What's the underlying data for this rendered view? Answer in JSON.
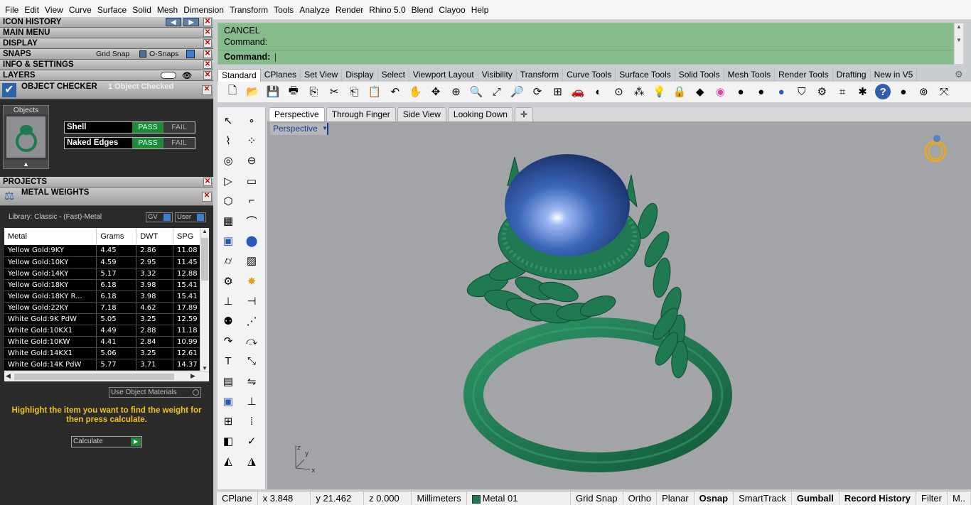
{
  "menu": [
    "File",
    "Edit",
    "View",
    "Curve",
    "Surface",
    "Solid",
    "Mesh",
    "Dimension",
    "Transform",
    "Tools",
    "Analyze",
    "Render",
    "Rhino 5.0",
    "Blend",
    "Clayoo",
    "Help"
  ],
  "panels": {
    "icon_history": "ICON HISTORY",
    "main_menu": "MAIN MENU",
    "display": "DISPLAY",
    "snaps": "SNAPS",
    "grid_snap": "Grid Snap",
    "o_snaps": "O-Snaps",
    "info_settings": "INFO & SETTINGS",
    "layers": "LAYERS",
    "object_checker": "OBJECT CHECKER",
    "object_checked": "1 Object Checked",
    "objects_label": "Objects",
    "checks": [
      {
        "name": "Shell",
        "pass": "PASS",
        "fail": "FAIL"
      },
      {
        "name": "Naked Edges",
        "pass": "PASS",
        "fail": "FAIL"
      }
    ],
    "projects": "PROJECTS",
    "metal_weights": "METAL WEIGHTS",
    "library": "Library: Classic - (Fast)-Metal",
    "gv": "GV",
    "user": "User",
    "use_object_materials": "Use Object Materials",
    "hint": "Highlight the item you want to find the weight for then press calculate.",
    "calculate": "Calculate"
  },
  "metal_table": {
    "headers": [
      "Metal",
      "Grams",
      "DWT",
      "SPG"
    ],
    "rows": [
      [
        "Yellow Gold:9KY",
        "4.45",
        "2.86",
        "11.08"
      ],
      [
        "Yellow Gold:10KY",
        "4.59",
        "2.95",
        "11.45"
      ],
      [
        "Yellow Gold:14KY",
        "5.17",
        "3.32",
        "12.88"
      ],
      [
        "Yellow Gold:18KY",
        "6.18",
        "3.98",
        "15.41"
      ],
      [
        "Yellow Gold:18KY R...",
        "6.18",
        "3.98",
        "15.41"
      ],
      [
        "Yellow Gold:22KY",
        "7.18",
        "4.62",
        "17.89"
      ],
      [
        "White Gold:9K PdW",
        "5.05",
        "3.25",
        "12.59"
      ],
      [
        "White Gold:10KX1",
        "4.49",
        "2.88",
        "11.18"
      ],
      [
        "White Gold:10KW",
        "4.41",
        "2.84",
        "10.99"
      ],
      [
        "White Gold:14KX1",
        "5.06",
        "3.25",
        "12.61"
      ],
      [
        "White Gold:14K PdW",
        "5.77",
        "3.71",
        "14.37"
      ]
    ]
  },
  "command": {
    "line1": "CANCEL",
    "line2": "Command:",
    "prompt": "Command:"
  },
  "toolbar_tabs": [
    "Standard",
    "CPlanes",
    "Set View",
    "Display",
    "Select",
    "Viewport Layout",
    "Visibility",
    "Transform",
    "Curve Tools",
    "Surface Tools",
    "Solid Tools",
    "Mesh Tools",
    "Render Tools",
    "Drafting",
    "New in V5"
  ],
  "viewport_tabs": [
    "Perspective",
    "Through Finger",
    "Side View",
    "Looking Down"
  ],
  "viewport_label": "Perspective",
  "status": {
    "cplane": "CPlane",
    "x": "x 3.848",
    "y": "y 21.462",
    "z": "z 0.000",
    "units": "Millimeters",
    "layer": "Metal 01",
    "grid_snap": "Grid Snap",
    "ortho": "Ortho",
    "planar": "Planar",
    "osnap": "Osnap",
    "smarttrack": "SmartTrack",
    "gumball": "Gumball",
    "record_history": "Record History",
    "filter": "Filter",
    "more": "M.."
  },
  "colors": {
    "command_bg": "#86bc8c",
    "viewport_bg": "#a2a4a8",
    "ring_green": "#1f7a52",
    "gem_blue": "#3b66b8",
    "pass_green": "#1e8a3a",
    "hint_yellow": "#f0c020"
  }
}
